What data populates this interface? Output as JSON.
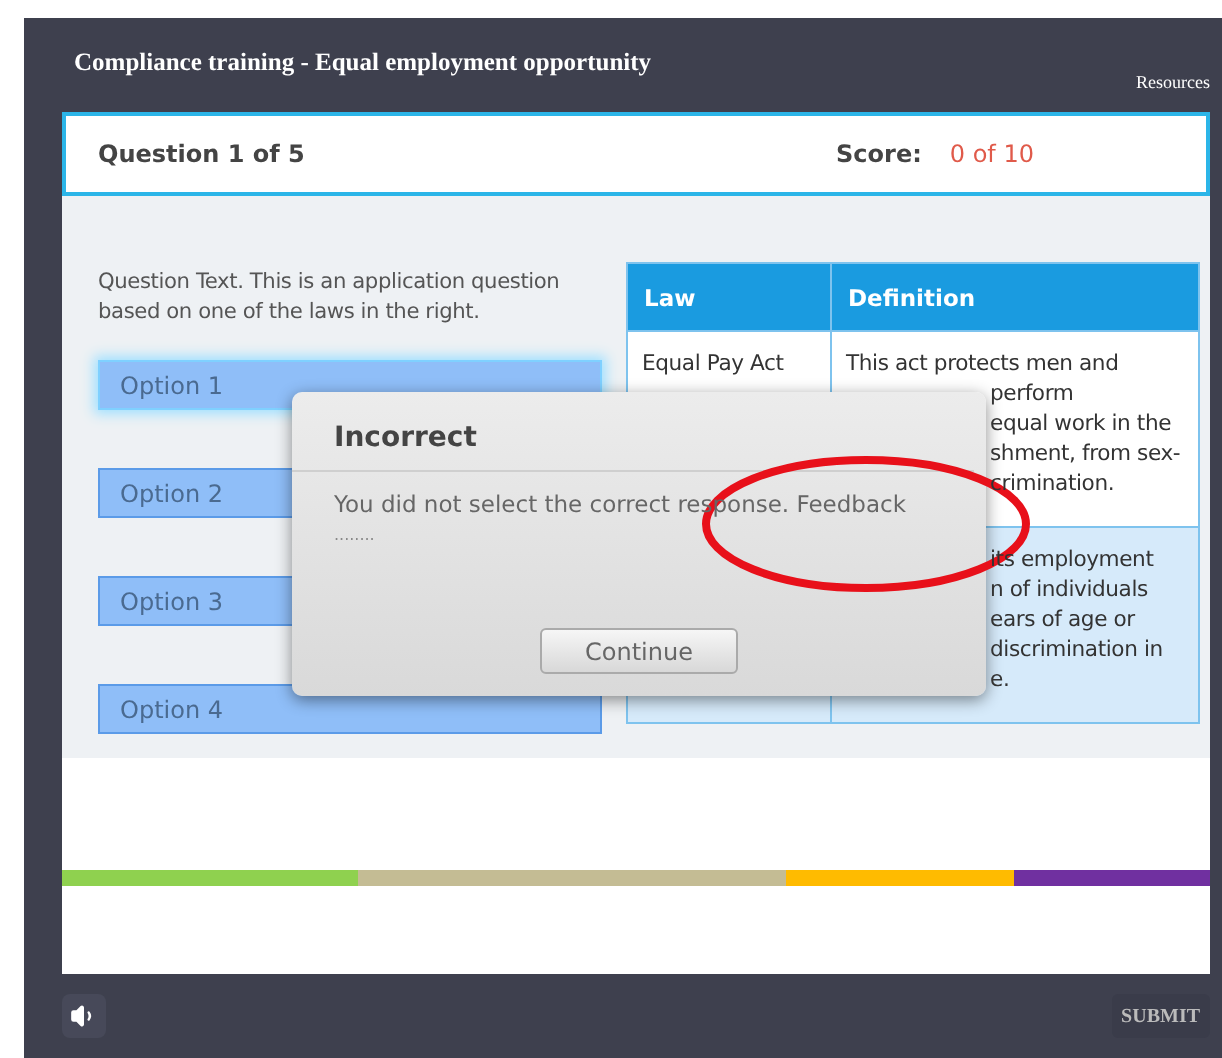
{
  "title": "Compliance training - Equal employment opportunity",
  "resources_link": "Resources",
  "question_header": {
    "label": "Question 1 of 5",
    "score_label": "Score:",
    "score_value": "0 of 10"
  },
  "question_text": "Question Text. This is an application question based on one of the laws in the right.",
  "options": [
    {
      "label": "Option 1",
      "selected": true
    },
    {
      "label": "Option 2",
      "selected": false
    },
    {
      "label": "Option 3",
      "selected": false
    },
    {
      "label": "Option 4",
      "selected": false
    }
  ],
  "law_table": {
    "columns": [
      "Law",
      "Definition"
    ],
    "rows": [
      {
        "highlighted": false,
        "law": [
          "Equal Pay Act"
        ],
        "definition": [
          {
            "text": "This act protects men and",
            "clipped": false
          },
          {
            "text": "perform",
            "clipped": true
          },
          {
            "text": "equal work in the",
            "clipped": true
          },
          {
            "text": "shment, from sex-",
            "clipped": true
          },
          {
            "text": "crimination.",
            "clipped": true
          }
        ]
      },
      {
        "highlighted": true,
        "definition": [
          {
            "text": "its employment",
            "clipped": true
          },
          {
            "text": "n of individuals",
            "clipped": true
          },
          {
            "text": "ears of age or",
            "clipped": true
          },
          {
            "text": "discrimination in",
            "clipped": true
          },
          {
            "text": "e.",
            "clipped": true
          }
        ]
      }
    ]
  },
  "dialog": {
    "title": "Incorrect",
    "message": "You did not select the correct response. Feedback",
    "message_more": "........",
    "button": "Continue"
  },
  "progress_segments": [
    {
      "color": "#8fd14f"
    },
    {
      "color": "#c4bc94"
    },
    {
      "color": "#ffbb00"
    },
    {
      "color": "#7030a0"
    }
  ],
  "footer": {
    "submit": "SUBMIT"
  }
}
